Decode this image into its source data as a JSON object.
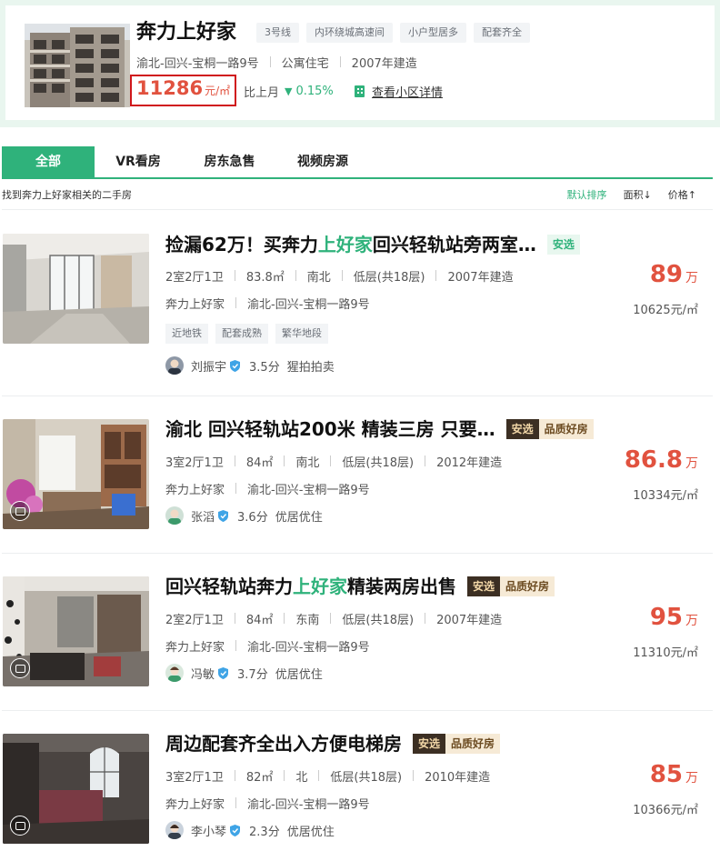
{
  "community": {
    "name": "奔力上好家",
    "tags": [
      "3号线",
      "内环绕城高速间",
      "小户型居多",
      "配套齐全"
    ],
    "location": "渝北-回兴-宝桐一路9号",
    "property_type": "公寓住宅",
    "build_year": "2007年建造",
    "price": "11286",
    "price_unit": "元/㎡",
    "mom_label": "比上月",
    "mom_arrow": "▼",
    "mom_change": "0.15%",
    "detail_link": "查看小区详情"
  },
  "tabs": [
    {
      "label": "全部",
      "active": true
    },
    {
      "label": "VR看房",
      "active": false
    },
    {
      "label": "房东急售",
      "active": false
    },
    {
      "label": "视频房源",
      "active": false
    }
  ],
  "subbar": {
    "info": "找到奔力上好家相关的二手房",
    "sort_default": "默认排序",
    "sort_area": "面积↓",
    "sort_price": "价格↑"
  },
  "listings": [
    {
      "title_before": "捡漏62万！买奔力",
      "title_highlight": "上好家",
      "title_after": "回兴轻轨站旁两室…",
      "badge_anxuan": "安选",
      "badge_pinzhi": "",
      "layout": "2室2厅1卫",
      "area": "83.8㎡",
      "orientation": "南北",
      "floor": "低层(共18层)",
      "year": "2007年建造",
      "community": "奔力上好家",
      "address": "渝北-回兴-宝桐一路9号",
      "feature_tags": [
        "近地铁",
        "配套成熟",
        "繁华地段"
      ],
      "agent": "刘振宇",
      "score": "3.5分",
      "agent_note": "猩拍拍卖",
      "price": "89",
      "price_unit": "万",
      "unit_price": "10625元/㎡"
    },
    {
      "title_before": "渝北 回兴轻轨站200米 精装三房 只要…",
      "title_highlight": "",
      "title_after": "",
      "badge_anxuan": "安选",
      "badge_pinzhi": "品质好房",
      "layout": "3室2厅1卫",
      "area": "84㎡",
      "orientation": "南北",
      "floor": "低层(共18层)",
      "year": "2012年建造",
      "community": "奔力上好家",
      "address": "渝北-回兴-宝桐一路9号",
      "feature_tags": [],
      "agent": "张滔",
      "score": "3.6分",
      "agent_note": "优居优住",
      "price": "86.8",
      "price_unit": "万",
      "unit_price": "10334元/㎡"
    },
    {
      "title_before": "回兴轻轨站奔力",
      "title_highlight": "上好家",
      "title_after": "精装两房出售",
      "badge_anxuan": "安选",
      "badge_pinzhi": "品质好房",
      "layout": "2室2厅1卫",
      "area": "84㎡",
      "orientation": "东南",
      "floor": "低层(共18层)",
      "year": "2007年建造",
      "community": "奔力上好家",
      "address": "渝北-回兴-宝桐一路9号",
      "feature_tags": [],
      "agent": "冯敏",
      "score": "3.7分",
      "agent_note": "优居优住",
      "price": "95",
      "price_unit": "万",
      "unit_price": "11310元/㎡"
    },
    {
      "title_before": "周边配套齐全出入方便电梯房",
      "title_highlight": "",
      "title_after": "",
      "badge_anxuan": "安选",
      "badge_pinzhi": "品质好房",
      "layout": "3室2厅1卫",
      "area": "82㎡",
      "orientation": "北",
      "floor": "低层(共18层)",
      "year": "2010年建造",
      "community": "奔力上好家",
      "address": "渝北-回兴-宝桐一路9号",
      "feature_tags": [],
      "agent": "李小琴",
      "score": "2.3分",
      "agent_note": "优居优住",
      "price": "85",
      "price_unit": "万",
      "unit_price": "10366元/㎡"
    }
  ],
  "colors": {
    "accent": "#2fb27b",
    "price": "#e1523f",
    "highlight_box": "#d0161b"
  },
  "icons": [
    "building-icon",
    "arrow-down-icon",
    "verified-shield-icon",
    "vr-icon"
  ]
}
